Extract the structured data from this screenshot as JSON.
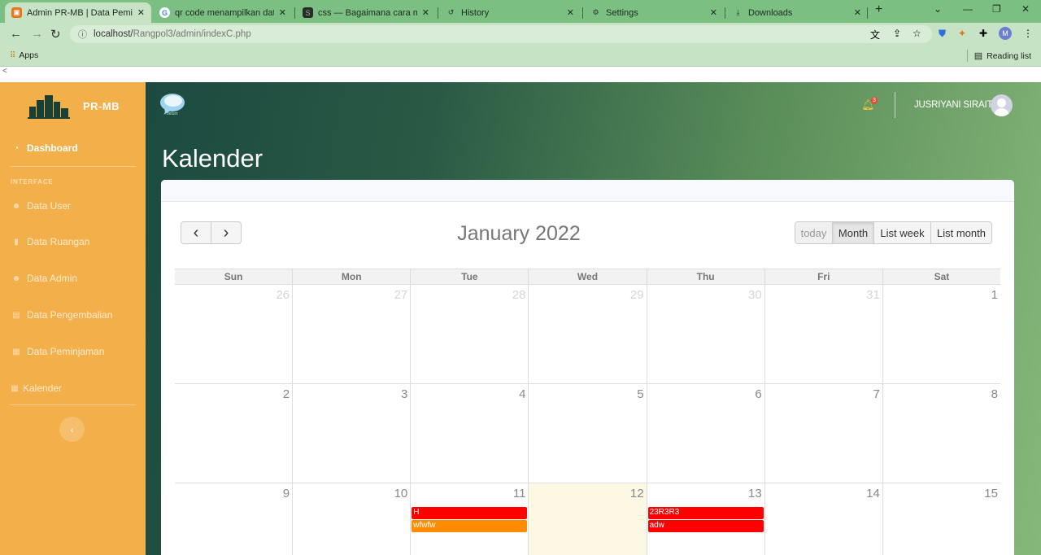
{
  "browser": {
    "tabs": [
      {
        "title": "Admin PR-MB | Data Peminjaman",
        "icon": "site-favicon",
        "color": "#e8761d"
      },
      {
        "title": "qr code menampilkan data - Google Search",
        "icon": "google-icon",
        "color": "#4285f4"
      },
      {
        "title": "css — Bagaimana cara mengubah",
        "icon": "stackexchange-icon",
        "color": "#2b2b2b"
      },
      {
        "title": "History",
        "icon": "history-icon",
        "color": "#333333"
      },
      {
        "title": "Settings",
        "icon": "settings-gear-icon",
        "color": "#333333"
      },
      {
        "title": "Downloads",
        "icon": "download-icon",
        "color": "#333333"
      }
    ],
    "url_host": "localhost/",
    "url_path": "Rangpol3/admin/indexC.php",
    "bookmarks": {
      "apps": "Apps",
      "reading_list": "Reading list"
    },
    "page_strip": "<"
  },
  "sidebar": {
    "brand": "PR-MB",
    "heading": "INTERFACE",
    "items": [
      {
        "label": "Dashboard",
        "icon": "tachometer-icon"
      },
      {
        "label": "Data User",
        "icon": "users-icon"
      },
      {
        "label": "Data Ruangan",
        "icon": "file-icon"
      },
      {
        "label": "Data Admin",
        "icon": "users-icon"
      },
      {
        "label": "Data Pengembalian",
        "icon": "clipboard-icon"
      },
      {
        "label": "Data Peminjaman",
        "icon": "table-icon"
      },
      {
        "label": "Kalender",
        "icon": "calendar-icon"
      }
    ],
    "toggle_icon": "‹"
  },
  "topbar": {
    "notification_count": "3",
    "user_name": "JUSRIYANI SIRAIT",
    "logo_label": "belum"
  },
  "page": {
    "title": "Kalender"
  },
  "calendar": {
    "title": "January 2022",
    "nav": {
      "prev": "‹",
      "next": "›"
    },
    "views": [
      "today",
      "Month",
      "List week",
      "List month"
    ],
    "active_view": "Month",
    "weekdays": [
      "Sun",
      "Mon",
      "Tue",
      "Wed",
      "Thu",
      "Fri",
      "Sat"
    ],
    "weeks": [
      [
        {
          "d": "26",
          "other": true
        },
        {
          "d": "27",
          "other": true
        },
        {
          "d": "28",
          "other": true
        },
        {
          "d": "29",
          "other": true
        },
        {
          "d": "30",
          "other": true
        },
        {
          "d": "31",
          "other": true
        },
        {
          "d": "1"
        }
      ],
      [
        {
          "d": "2"
        },
        {
          "d": "3"
        },
        {
          "d": "4"
        },
        {
          "d": "5"
        },
        {
          "d": "6"
        },
        {
          "d": "7"
        },
        {
          "d": "8"
        }
      ],
      [
        {
          "d": "9"
        },
        {
          "d": "10"
        },
        {
          "d": "11",
          "events": [
            {
              "title": "H",
              "color": "#ff0000"
            },
            {
              "title": "wfwfw",
              "color": "#ff8c00"
            }
          ]
        },
        {
          "d": "12",
          "today": true
        },
        {
          "d": "13",
          "events": [
            {
              "title": "23R3R3",
              "color": "#ff0000"
            },
            {
              "title": "adw",
              "color": "#ff0000"
            }
          ]
        },
        {
          "d": "14"
        },
        {
          "d": "15"
        }
      ]
    ]
  }
}
